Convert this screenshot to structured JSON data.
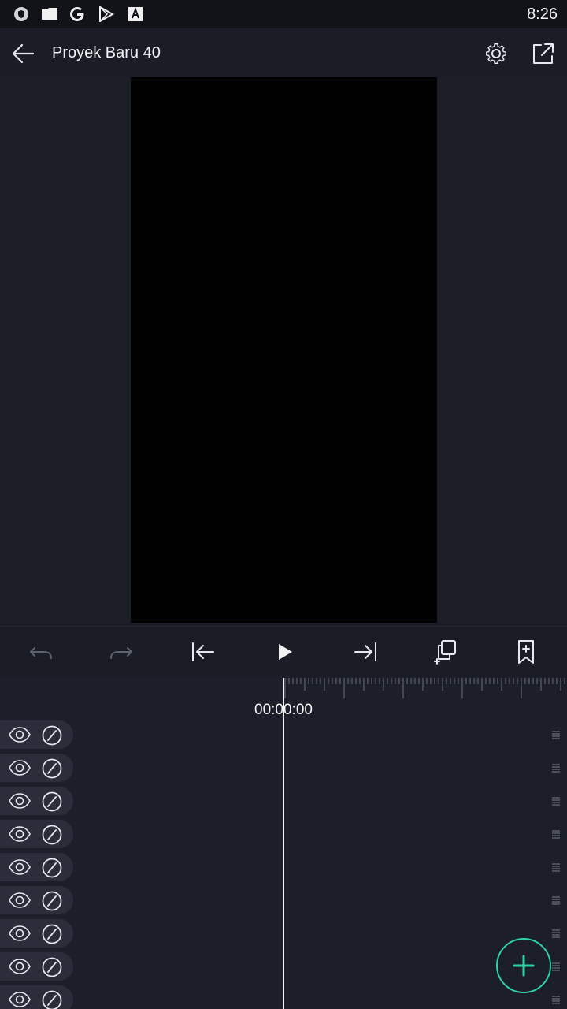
{
  "status_bar": {
    "time": "8:26",
    "icons": [
      "shield-icon",
      "folder-icon",
      "google-icon",
      "play-store-icon",
      "font-icon"
    ]
  },
  "app_bar": {
    "title": "Proyek Baru 40",
    "back_icon": "arrow-left-icon",
    "settings_icon": "gear-icon",
    "export_icon": "share-icon"
  },
  "toolbar": {
    "items": [
      "undo-icon",
      "redo-icon",
      "skip-to-start-icon",
      "play-icon",
      "skip-to-end-icon",
      "duplicate-icon",
      "bookmark-add-icon"
    ]
  },
  "timeline": {
    "timecode": "00:00:00",
    "layer_count": 9
  },
  "colors": {
    "accent": "#2ed3a4",
    "background": "#1b1e27",
    "status_bar": "#111318",
    "preview": "#000000"
  }
}
